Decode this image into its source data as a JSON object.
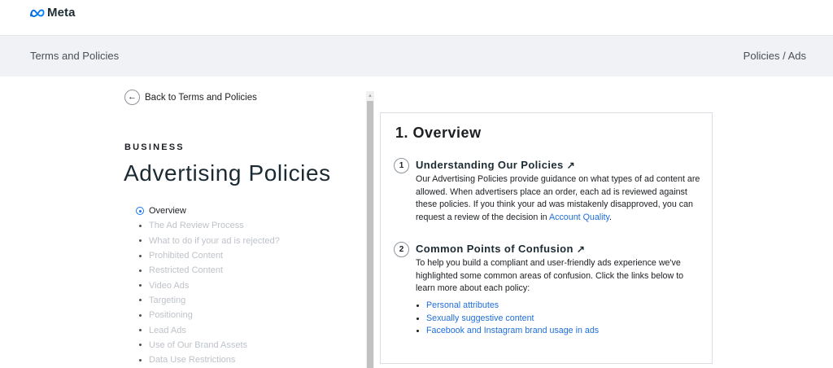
{
  "brand": {
    "name": "Meta"
  },
  "subnav": {
    "left": "Terms and Policies",
    "right": "Policies / Ads"
  },
  "back": {
    "label": "Back to Terms and Policies",
    "icon": "arrow-left-icon"
  },
  "sidebar": {
    "eyebrow": "BUSINESS",
    "title": "Advertising Policies",
    "items": [
      {
        "label": "Overview",
        "active": true
      },
      {
        "label": "The Ad Review Process"
      },
      {
        "label": "What to do if your ad is rejected?"
      },
      {
        "label": "Prohibited Content"
      },
      {
        "label": "Restricted Content"
      },
      {
        "label": "Video Ads"
      },
      {
        "label": "Targeting"
      },
      {
        "label": "Positioning"
      },
      {
        "label": "Lead Ads"
      },
      {
        "label": "Use of Our Brand Assets"
      },
      {
        "label": "Data Use Restrictions"
      }
    ]
  },
  "main": {
    "title": "1. Overview",
    "sections": [
      {
        "number": "1",
        "heading": "Understanding Our Policies",
        "arrow": "↗",
        "body": "Our Advertising Policies provide guidance on what types of ad content are allowed. When advertisers place an order, each ad is reviewed against these policies. If you think your ad was mistakenly disapproved, you can request a review of the decision in",
        "link": "Account Quality",
        "after": "."
      },
      {
        "number": "2",
        "heading": "Common Points of Confusion",
        "arrow": "↗",
        "body": "To help you build a compliant and user-friendly ads experience we've highlighted some common areas of confusion. Click the links below to learn more about each policy:",
        "links": [
          "Personal attributes",
          "Sexually suggestive content",
          "Facebook and Instagram brand usage in ads"
        ]
      }
    ]
  },
  "colors": {
    "link": "#216fdb",
    "subnav_bg": "#f0f2f5",
    "accent": "#1877f2"
  }
}
